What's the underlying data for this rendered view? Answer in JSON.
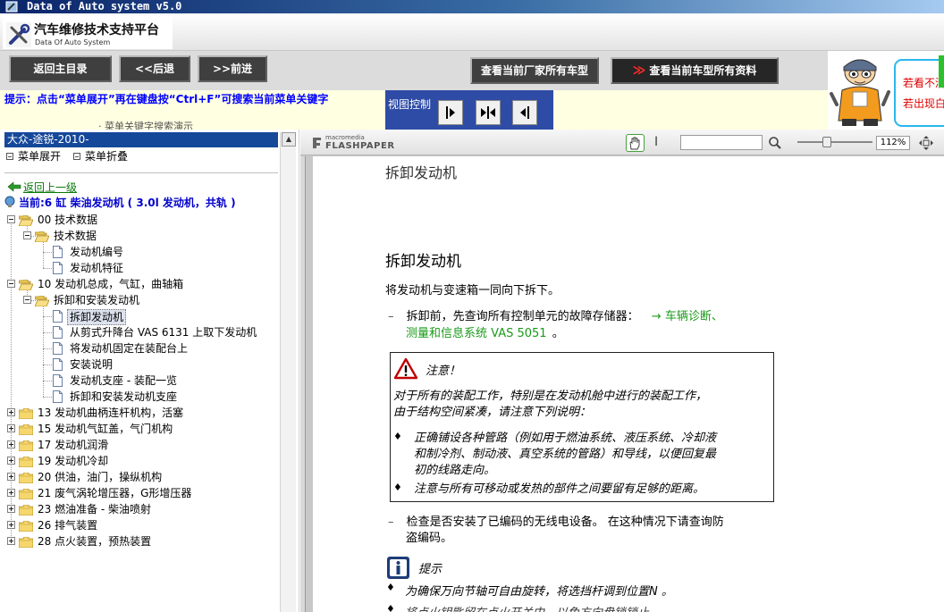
{
  "window": {
    "title": "Data of Auto system v5.0"
  },
  "header": {
    "title": "汽车维修技术支持平台",
    "subtitle": "Data Of Auto System"
  },
  "nav": {
    "home": "返回主目录",
    "back": "<<后退",
    "forward": ">>前进",
    "all_models": "查看当前厂家所有车型",
    "all_data_prefix": "≫",
    "all_data": "查看当前车型所有资料"
  },
  "hint": {
    "text": "提示：点击“菜单展开”再在键盘按“Ctrl+F”可搜索当前菜单关键字",
    "cut_text": "· 菜单关键字搜索演示",
    "view_control": "视图控制"
  },
  "mascot": {
    "line1": "若看不清",
    "line2": "若出现白"
  },
  "left_panel": {
    "model": "大众-途锐-2010-",
    "expand_menu": "菜单展开",
    "collapse_menu": "菜单折叠",
    "back_level": "返回上一级",
    "current": "当前:6 缸  柴油发动机 ( 3.0l 发动机，共轨 )"
  },
  "tree": [
    {
      "label": "00 技术数据",
      "level": 0,
      "type": "folder",
      "state": "open"
    },
    {
      "label": "技术数据",
      "level": 1,
      "type": "folder",
      "state": "open"
    },
    {
      "label": "发动机编号",
      "level": 2,
      "type": "doc"
    },
    {
      "label": "发动机特征",
      "level": 2,
      "type": "doc"
    },
    {
      "label": "10 发动机总成，气缸，曲轴箱",
      "level": 0,
      "type": "folder",
      "state": "open"
    },
    {
      "label": "拆卸和安装发动机",
      "level": 1,
      "type": "folder",
      "state": "open"
    },
    {
      "label": "拆卸发动机",
      "level": 2,
      "type": "doc",
      "selected": true
    },
    {
      "label": "从剪式升降台  VAS 6131 上取下发动机",
      "level": 2,
      "type": "doc"
    },
    {
      "label": "将发动机固定在装配台上",
      "level": 2,
      "type": "doc"
    },
    {
      "label": "安装说明",
      "level": 2,
      "type": "doc"
    },
    {
      "label": "发动机支座  - 装配一览",
      "level": 2,
      "type": "doc"
    },
    {
      "label": "拆卸和安装发动机支座",
      "level": 2,
      "type": "doc"
    },
    {
      "label": "13 发动机曲柄连杆机构，活塞",
      "level": 0,
      "type": "folder",
      "state": "closed"
    },
    {
      "label": "15 发动机气缸盖，气门机构",
      "level": 0,
      "type": "folder",
      "state": "closed"
    },
    {
      "label": "17 发动机润滑",
      "level": 0,
      "type": "folder",
      "state": "closed"
    },
    {
      "label": "19 发动机冷却",
      "level": 0,
      "type": "folder",
      "state": "closed"
    },
    {
      "label": "20 供油，油门，操纵机构",
      "level": 0,
      "type": "folder",
      "state": "closed"
    },
    {
      "label": "21 废气涡轮增压器，G形增压器",
      "level": 0,
      "type": "folder",
      "state": "closed"
    },
    {
      "label": "23 燃油准备  - 柴油喷射",
      "level": 0,
      "type": "folder",
      "state": "closed"
    },
    {
      "label": "26 排气装置",
      "level": 0,
      "type": "folder",
      "state": "closed"
    },
    {
      "label": "28 点火装置，预热装置",
      "level": 0,
      "type": "folder",
      "state": "closed"
    }
  ],
  "viewer": {
    "brand_top": "macromedia",
    "brand_main": "FLASHPAPER",
    "zoom": "112%"
  },
  "document": {
    "page_header": "拆卸发动机",
    "heading": "拆卸发动机",
    "intro": "将发动机与变速箱一同向下拆下。",
    "dash": "–",
    "step1_a": "拆卸前，先查询所有控制单元的故障存储器：",
    "step1_link1": "→ 车辆诊断、",
    "step1_link2": "测量和信息系统  VAS 5051",
    "step1_end": "。",
    "notice_title": "注意！",
    "notice_line1": "对于所有的装配工作，特别是在发动机舱中进行的装配工作，",
    "notice_line2": "由于结构空间紧凑，请注意下列说明：",
    "bullet": "♦",
    "notice_b1_l1": "正确铺设各种管路（例如用于燃油系统、液压系统、冷却液",
    "notice_b1_l2": "和制冷剂、制动液、真空系统的管路）和导线，以便回复最",
    "notice_b1_l3": "初的线路走向。",
    "notice_b2": "注意与所有可移动或发热的部件之间要留有足够的距离。",
    "step2_l1": "检查是否安装了已编码的无线电设备。  在这种情况下请查询防",
    "step2_l2": "盗编码。",
    "tip_title": "提示",
    "tip_b1": "为确保万向节轴可自由旋转，将选挡杆调到位置N 。",
    "tip_b2": "将点火钥匙留在点火开关中，以免方向盘锁锁止。"
  }
}
